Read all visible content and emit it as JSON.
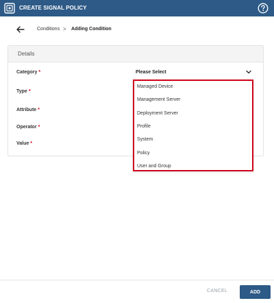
{
  "header": {
    "title": "CREATE SIGNAL POLICY",
    "app_icon": "app-logo-icon",
    "help_icon": "help-circle-icon",
    "bg_color": "#2d5a86"
  },
  "breadcrumb": {
    "back_icon": "arrow-left-icon",
    "parent": "Conditions",
    "separator": ">",
    "current": "Adding Condition"
  },
  "details": {
    "title": "Details",
    "fields": [
      {
        "label": "Category",
        "required": "*"
      },
      {
        "label": "Type",
        "required": "*"
      },
      {
        "label": "Attribute",
        "required": "*"
      },
      {
        "label": "Operator",
        "required": "*"
      },
      {
        "label": "Value",
        "required": "*"
      }
    ],
    "category_select": {
      "value": "Please Select",
      "chevron_icon": "chevron-down-icon",
      "options": [
        "Managed Device",
        "Management Server",
        "Deployment Server",
        "Profile",
        "System",
        "Policy",
        "User and Group"
      ],
      "highlight_color": "#d0021b"
    }
  },
  "footer": {
    "cancel_label": "CANCEL",
    "add_label": "ADD"
  }
}
